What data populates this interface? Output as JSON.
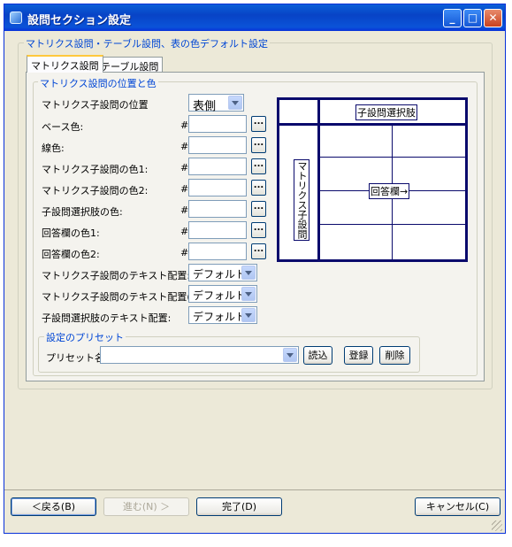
{
  "window": {
    "title": "設問セクション設定"
  },
  "group_main": {
    "title": "マトリクス設問・テーブル設問、表の色デフォルト設定"
  },
  "tabs": [
    {
      "label": "マトリクス設問"
    },
    {
      "label": "テーブル設問"
    }
  ],
  "group_colors": {
    "title": "マトリクス設問の位置と色"
  },
  "fields": {
    "position_label": "マトリクス子設問の位置",
    "position_value": "表側",
    "base_color": "ベース色:",
    "line_color": "線色:",
    "sub_color1": "マトリクス子設問の色1:",
    "sub_color2": "マトリクス子設問の色2:",
    "choice_color": "子設問選択肢の色:",
    "answer_color1": "回答欄の色1:",
    "answer_color2": "回答欄の色2:",
    "hash": "#",
    "dots": "...",
    "text_align_label": "マトリクス子設問のテキスト配置:",
    "text_align_right_label": "マトリクス子設問のテキスト配置(右):",
    "choice_align_label": "子設問選択肢のテキスト配置:",
    "align_default": "デフォルト"
  },
  "preview": {
    "header_label": "子設問選択肢",
    "side_label": "マトリクス子設問",
    "answer_label": "回答欄→"
  },
  "preset": {
    "title": "設定のプリセット",
    "name_label": "プリセット名:",
    "load": "読込",
    "save": "登録",
    "delete": "削除"
  },
  "footer": {
    "back": "＜戻る(B)",
    "next": "進む(N) ＞",
    "finish": "完了(D)",
    "cancel": "キャンセル(C)"
  },
  "colors": {
    "title_bar": "#0a53d8",
    "grid_lines": "#0a0a6c",
    "accent": "#0046d5"
  }
}
